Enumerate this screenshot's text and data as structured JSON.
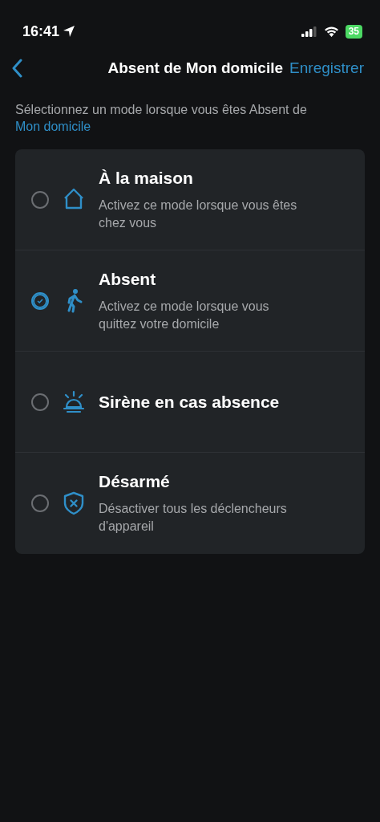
{
  "status_bar": {
    "time": "16:41",
    "battery": "35"
  },
  "header": {
    "title": "Absent de Mon domicile",
    "action": "Enregistrer"
  },
  "description": {
    "text": "Sélectionnez un mode lorsque vous êtes Absent de",
    "link": "Mon domicile"
  },
  "modes": [
    {
      "kind": "home",
      "title": "À la maison",
      "subtitle": "Activez ce mode lorsque vous êtes chez vous",
      "selected": false
    },
    {
      "kind": "walk",
      "title": "Absent",
      "subtitle": "Activez ce mode lorsque vous quittez votre domicile",
      "selected": true
    },
    {
      "kind": "siren",
      "title": "Sirène en cas absence",
      "selected": false
    },
    {
      "kind": "shield",
      "title": "Désarmé",
      "subtitle": "Désactiver tous les déclencheurs d'appareil",
      "selected": false
    }
  ]
}
